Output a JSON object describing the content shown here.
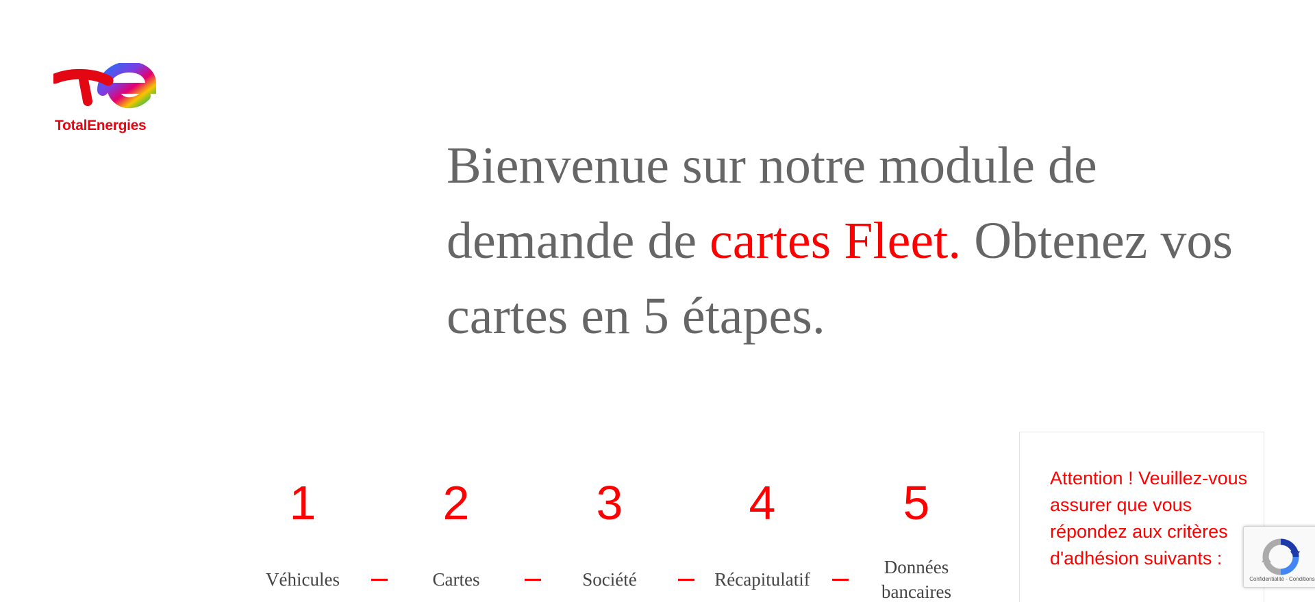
{
  "logo": {
    "name": "TotalEnergies",
    "colors": {
      "brand_red": "#e30613"
    }
  },
  "headline": {
    "before": "Bienvenue sur notre module de demande de ",
    "accent": "cartes Fleet.",
    "after": " Obtenez vos cartes en 5 étapes.",
    "colors": {
      "text": "#666666",
      "accent": "#ff0000"
    }
  },
  "steps": [
    {
      "number": "1",
      "label": "Véhicules"
    },
    {
      "number": "2",
      "label": "Cartes"
    },
    {
      "number": "3",
      "label": "Société"
    },
    {
      "number": "4",
      "label": "Récapitulatif"
    },
    {
      "number": "5",
      "label": "Données bancaires"
    }
  ],
  "notice": {
    "text": "Attention ! Veuillez-vous assurer que vous répondez aux critères d'adhésion suivants :"
  },
  "recaptcha": {
    "icon": "recaptcha-icon",
    "privacy": "Confidentialité",
    "separator": " - ",
    "terms": "Conditions"
  }
}
